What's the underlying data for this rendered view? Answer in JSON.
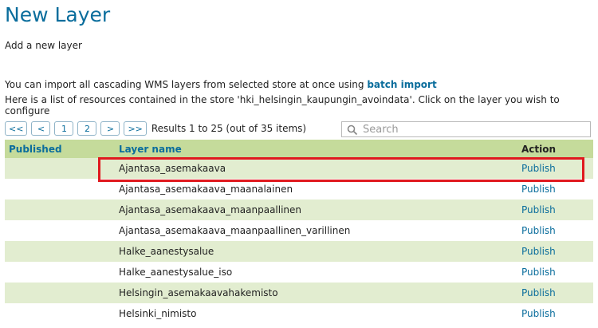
{
  "page": {
    "title": "New Layer",
    "subtitle": "Add a new layer",
    "import_text": "You can import all cascading WMS layers from selected store at once using ",
    "import_link": "batch import",
    "store_text": "Here is a list of resources contained in the store 'hki_helsingin_kaupungin_avoindata'. Click on the layer you wish to configure"
  },
  "pager": {
    "first": "<<",
    "prev": "<",
    "pages": [
      "1",
      "2"
    ],
    "next": ">",
    "last": ">>",
    "info": "Results 1 to 25 (out of 35 items)"
  },
  "search": {
    "placeholder": "Search",
    "icon": "search-icon"
  },
  "table": {
    "headers": {
      "published": "Published",
      "layer_name": "Layer name",
      "action": "Action"
    },
    "rows": [
      {
        "published": "",
        "name": "Ajantasa_asemakaava",
        "action": "Publish"
      },
      {
        "published": "",
        "name": "Ajantasa_asemakaava_maanalainen",
        "action": "Publish"
      },
      {
        "published": "",
        "name": "Ajantasa_asemakaava_maanpaallinen",
        "action": "Publish"
      },
      {
        "published": "",
        "name": "Ajantasa_asemakaava_maanpaallinen_varillinen",
        "action": "Publish"
      },
      {
        "published": "",
        "name": "Halke_aanestysalue",
        "action": "Publish"
      },
      {
        "published": "",
        "name": "Halke_aanestysalue_iso",
        "action": "Publish"
      },
      {
        "published": "",
        "name": "Helsingin_asemakaavahakemisto",
        "action": "Publish"
      },
      {
        "published": "",
        "name": "Helsinki_nimisto",
        "action": "Publish"
      }
    ]
  },
  "colors": {
    "accent": "#0a6d9c",
    "header_bg": "#c5db9b",
    "row_alt": "#e2edd0",
    "highlight": "#e0191e"
  }
}
